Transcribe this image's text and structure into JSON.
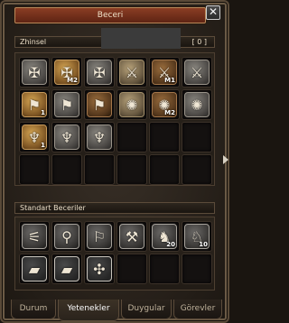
{
  "window": {
    "title": "Beceri",
    "close_glyph": "✕"
  },
  "main_section": {
    "label": "Zhinsel",
    "points": "[ 0 ]"
  },
  "main_skills": [
    {
      "icon": "whirl-blade-icon",
      "style": "s-grey",
      "glyph": "✠",
      "level": ""
    },
    {
      "icon": "whirl-blade-master-icon",
      "style": "s-gold",
      "glyph": "✠",
      "level": "M2"
    },
    {
      "icon": "cross-slash-icon",
      "style": "s-grey",
      "glyph": "✠",
      "level": ""
    },
    {
      "icon": "sword-strike-icon",
      "style": "s-tan",
      "glyph": "⚔",
      "level": ""
    },
    {
      "icon": "sword-strike-master-icon",
      "style": "s-bronze",
      "glyph": "⚔",
      "level": "M1"
    },
    {
      "icon": "sword-aura-icon",
      "style": "s-grey",
      "glyph": "⚔",
      "level": ""
    },
    {
      "icon": "boot-dash-icon",
      "style": "s-gold",
      "glyph": "⚑",
      "level": "1"
    },
    {
      "icon": "boot-dash-2-icon",
      "style": "s-grey",
      "glyph": "⚑",
      "level": ""
    },
    {
      "icon": "boot-dash-3-icon",
      "style": "s-bronze",
      "glyph": "⚑",
      "level": ""
    },
    {
      "icon": "star-seal-icon",
      "style": "s-tan",
      "glyph": "✺",
      "level": ""
    },
    {
      "icon": "star-seal-master-icon",
      "style": "s-bronze",
      "glyph": "✺",
      "level": "M2"
    },
    {
      "icon": "star-seal-3-icon",
      "style": "s-grey",
      "glyph": "✺",
      "level": ""
    },
    {
      "icon": "sword-spin-icon",
      "style": "s-gold",
      "glyph": "♆",
      "level": "1"
    },
    {
      "icon": "sword-spin-2-icon",
      "style": "s-grey",
      "glyph": "♆",
      "level": ""
    },
    {
      "icon": "sword-spin-3-icon",
      "style": "s-grey",
      "glyph": "♆",
      "level": ""
    }
  ],
  "standard_section": {
    "label": "Standart Beceriler"
  },
  "standard_skills": [
    {
      "icon": "leadership-icon",
      "style": "s-dark",
      "glyph": "⚟",
      "level": ""
    },
    {
      "icon": "fishing-icon",
      "style": "s-dark",
      "glyph": "⚲",
      "level": ""
    },
    {
      "icon": "flag-icon",
      "style": "s-dark",
      "glyph": "⚐",
      "level": ""
    },
    {
      "icon": "pickaxe-icon",
      "style": "s-dark",
      "glyph": "⚒",
      "level": ""
    },
    {
      "icon": "horse-icon",
      "style": "s-dark",
      "glyph": "♞",
      "level": "20"
    },
    {
      "icon": "horse-mount-icon",
      "style": "s-dark",
      "glyph": "♘",
      "level": "10"
    },
    {
      "icon": "red-book-icon",
      "style": "s-red",
      "glyph": "▰",
      "level": ""
    },
    {
      "icon": "yellow-book-icon",
      "style": "s-red",
      "glyph": "▰",
      "level": ""
    },
    {
      "icon": "knot-emblem-icon",
      "style": "s-red",
      "glyph": "✣",
      "level": ""
    }
  ],
  "tabs": [
    {
      "label": "Durum",
      "active": false
    },
    {
      "label": "Yetenekler",
      "active": true
    },
    {
      "label": "Duygular",
      "active": false
    },
    {
      "label": "Görevler",
      "active": false
    }
  ]
}
